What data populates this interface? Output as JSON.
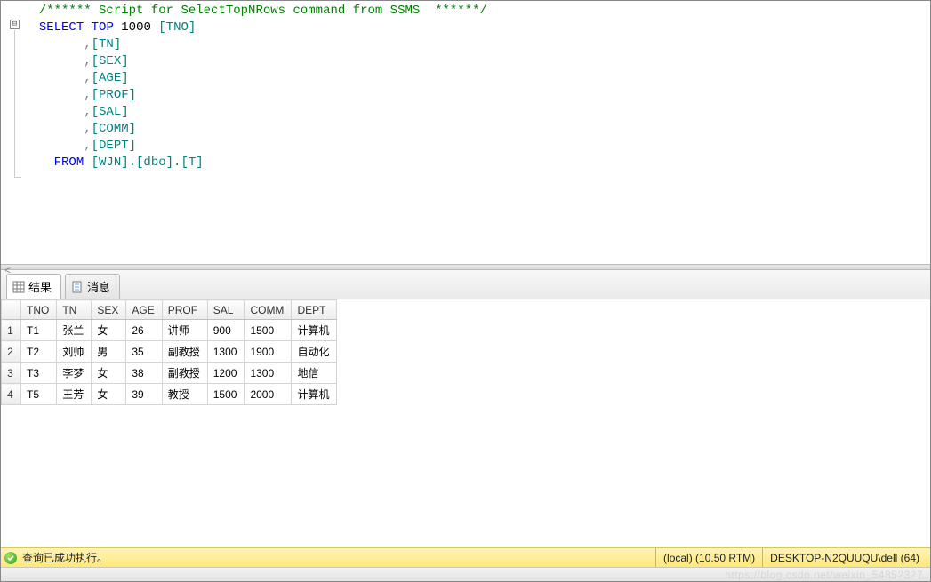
{
  "editor": {
    "comment": "/****** Script for SelectTopNRows command from SSMS  ******/",
    "kw_select": "SELECT",
    "kw_top": "TOP",
    "topn": "1000",
    "cols": [
      "[TNO]",
      "[TN]",
      "[SEX]",
      "[AGE]",
      "[PROF]",
      "[SAL]",
      "[COMM]",
      "[DEPT]"
    ],
    "kw_from": "FROM",
    "from_ident": "[WJN].[dbo].[T]",
    "collapse_glyph": "⊟",
    "scroll_glyph": "<"
  },
  "tabs": {
    "results": "结果",
    "messages": "消息"
  },
  "columns": {
    "tno": "TNO",
    "tn": "TN",
    "sex": "SEX",
    "age": "AGE",
    "prof": "PROF",
    "sal": "SAL",
    "comm": "COMM",
    "dept": "DEPT"
  },
  "rows": [
    {
      "n": "1",
      "tno": "T1",
      "tn": "张兰",
      "sex": "女",
      "age": "26",
      "prof": "讲师",
      "sal": "900",
      "comm": "1500",
      "dept": "计算机"
    },
    {
      "n": "2",
      "tno": "T2",
      "tn": "刘帅",
      "sex": "男",
      "age": "35",
      "prof": "副教授",
      "sal": "1300",
      "comm": "1900",
      "dept": "自动化"
    },
    {
      "n": "3",
      "tno": "T3",
      "tn": "李梦",
      "sex": "女",
      "age": "38",
      "prof": "副教授",
      "sal": "1200",
      "comm": "1300",
      "dept": "地信"
    },
    {
      "n": "4",
      "tno": "T5",
      "tn": "王芳",
      "sex": "女",
      "age": "39",
      "prof": "教授",
      "sal": "1500",
      "comm": "2000",
      "dept": "计算机"
    }
  ],
  "status": {
    "message": "查询已成功执行。",
    "server": "(local) (10.50 RTM)",
    "login": "DESKTOP-N2QUUQU\\dell (64)"
  },
  "watermark": "https://blog.csdn.net/weixin_54852327"
}
